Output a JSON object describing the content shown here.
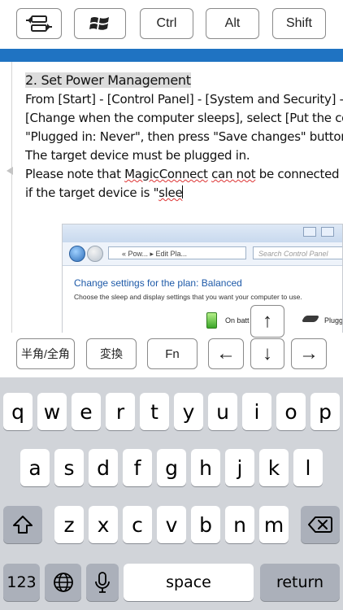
{
  "toolbar": {
    "ctrl": "Ctrl",
    "alt": "Alt",
    "shift": "Shift",
    "keyboard_toggle_icon": "keyboard-swap-icon",
    "windows_icon": "windows-logo-icon"
  },
  "document": {
    "heading": "2. Set Power Management",
    "line1": "From [Start] - [Control Panel] - [System and Security] - [Po",
    "line2": "[Change when the computer sleeps], select [Put the compu",
    "line3": "\"Plugged in: Never\", then press \"Save changes\" button.",
    "line4": "The target device must be plugged in.",
    "line5_a": "Please note that ",
    "line5_b": "MagicConnect",
    "line5_c": " ",
    "line5_d": "can not",
    "line5_e": " be connected from o",
    "line6_a": "if the target device is \"",
    "line6_b": "slee",
    "screenshot": {
      "address": "« Pow... ▸ Edit Pla...",
      "search_placeholder": "Search Control Panel",
      "title": "Change settings for the plan: Balanced",
      "subtitle": "Choose the sleep and display settings that you want your computer to use.",
      "on_battery": "On batt",
      "plugged": "Plugg"
    }
  },
  "function_keys": {
    "hankaku": "半角/全角",
    "henkan": "変換",
    "fn": "Fn",
    "left_arrow": "←",
    "up_arrow": "↑",
    "down_arrow": "↓",
    "right_arrow": "→"
  },
  "keyboard": {
    "row1": [
      "q",
      "w",
      "e",
      "r",
      "t",
      "y",
      "u",
      "i",
      "o",
      "p"
    ],
    "row2": [
      "a",
      "s",
      "d",
      "f",
      "g",
      "h",
      "j",
      "k",
      "l"
    ],
    "row3": [
      "z",
      "x",
      "c",
      "v",
      "b",
      "n",
      "m"
    ],
    "numbers": "123",
    "space": "space",
    "return": "return",
    "shift_icon": "shift-icon",
    "backspace_icon": "backspace-icon",
    "globe_icon": "globe-icon",
    "mic_icon": "microphone-icon"
  },
  "colors": {
    "accent_band": "#1f73c2",
    "keyboard_bg": "#d1d4d9"
  }
}
